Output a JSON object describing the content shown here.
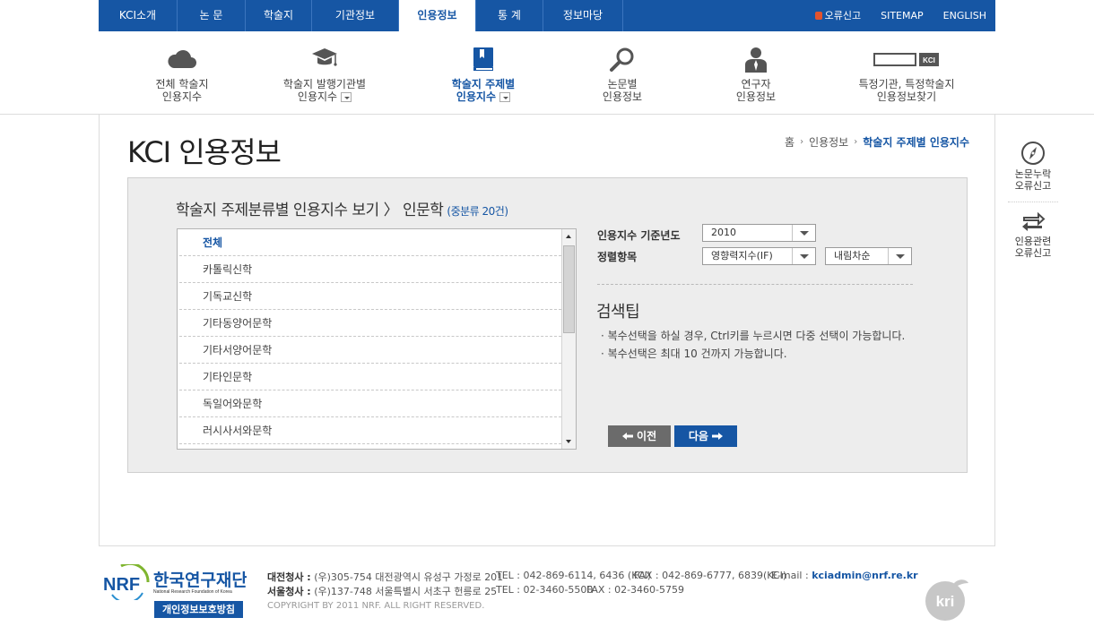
{
  "topnav": {
    "items": [
      {
        "label": "KCI소개"
      },
      {
        "label": "논 문"
      },
      {
        "label": "학술지"
      },
      {
        "label": "기관정보"
      },
      {
        "label": "인용정보"
      },
      {
        "label": "통 계"
      },
      {
        "label": "정보마당"
      }
    ],
    "active_index": 4,
    "utils": {
      "error_report": "오류신고",
      "sitemap": "SITEMAP",
      "english": "ENGLISH"
    }
  },
  "subnav": {
    "items": [
      {
        "line1": "전체 학술지",
        "line2": "인용지수",
        "icon": "cloud-icon"
      },
      {
        "line1": "학술지 발행기관별",
        "line2": "인용지수",
        "icon": "graduation-cap-icon"
      },
      {
        "line1": "학술지 주제별",
        "line2": "인용지수",
        "icon": "book-icon"
      },
      {
        "line1": "논문별",
        "line2": "인용정보",
        "icon": "magnifier-icon"
      },
      {
        "line1": "연구자",
        "line2": "인용정보",
        "icon": "person-icon"
      },
      {
        "line1": "특정기관, 특정학술지",
        "line2": "인용정보찾기",
        "icon": "search-box-icon",
        "badge": "KCI"
      }
    ],
    "active_index": 2
  },
  "page": {
    "title": "KCI 인용정보",
    "breadcrumb": {
      "home": "홈",
      "level1": "인용정보",
      "current": "학술지 주제별 인용지수"
    }
  },
  "panel": {
    "title": "학술지 주제분류별 인용지수 보기 〉 인문학",
    "count": "(중분류 20건)",
    "list": [
      "전체",
      "카톨릭신학",
      "기독교신학",
      "기타동양어문학",
      "기타서양어문학",
      "기타인문학",
      "독일어와문학",
      "러시사서와문학"
    ],
    "selected_index": 0,
    "year_label": "인용지수 기준년도",
    "year_value": "2010",
    "sort_label": "정렬항목",
    "sort_value": "영향력지수(IF)",
    "order_value": "내림차순",
    "tip_title": "검색팁",
    "tips": [
      "· 복수선택을 하실 경우, Ctrl키를 누르시면 다중 선택이 가능합니다.",
      "· 복수선택은 최대 10 건까지 가능합니다."
    ],
    "prev_label": "이전",
    "next_label": "다음"
  },
  "side": {
    "item1": {
      "line1": "논문누락",
      "line2": "오류신고"
    },
    "item2": {
      "line1": "인용관련",
      "line2": "오류신고"
    }
  },
  "footer": {
    "daejeon_label": "대전청사 :",
    "daejeon_addr": "(우)305-754 대전광역시 유성구 가정로 201",
    "daejeon_tel": "TEL : 042-869-6114, 6436 (KCI)",
    "daejeon_fax": "FAX : 042-869-6777, 6839(KCI)",
    "email_label": "E-mail :",
    "email": "kciadmin@nrf.re.kr",
    "seoul_label": "서울청사 :",
    "seoul_addr": "(우)137-748 서울특별시 서초구 헌릉로 25",
    "seoul_tel": "TEL : 02-3460-5500",
    "seoul_fax": "FAX : 02-3460-5759",
    "copyright": "COPYRIGHT BY 2011 NRF. ALL RIGHT RESERVED.",
    "logo_text": "NRF",
    "org_name": "한국연구재단",
    "org_name_en": "National Research Foundation of Korea",
    "privacy": "개인정보보호방침",
    "kri_logo": "kri"
  },
  "colors": {
    "brand": "#1656a4",
    "panel": "#ededed"
  }
}
